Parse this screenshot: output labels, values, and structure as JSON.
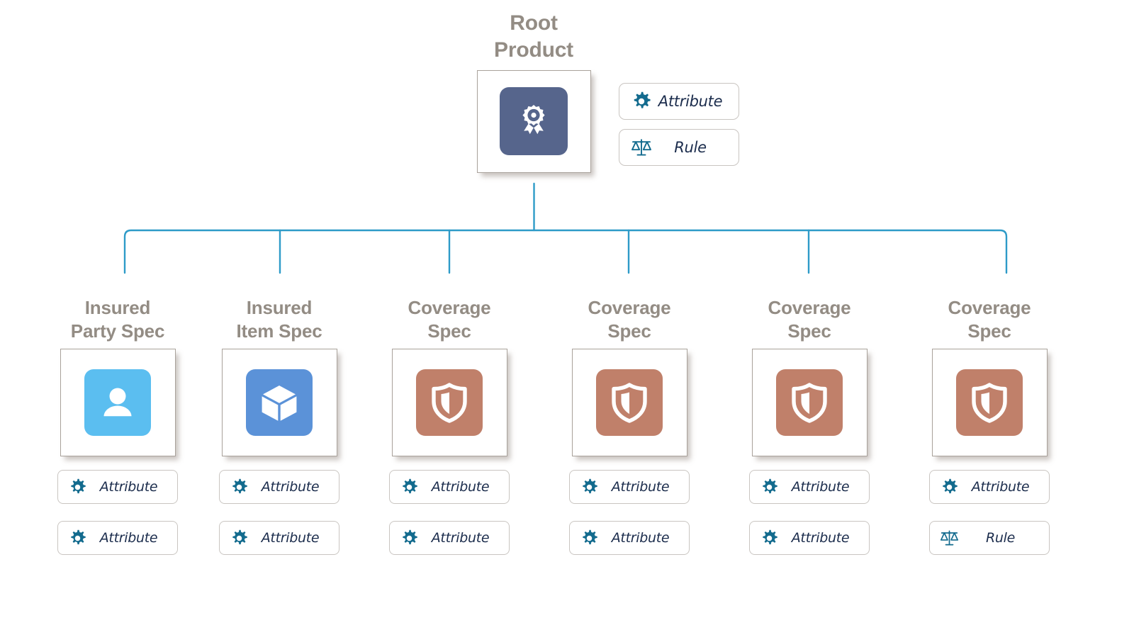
{
  "diagram": {
    "title_hidden": "",
    "colors": {
      "connector": "#2e9bc8",
      "label_text": "#938c84",
      "chip_border": "#c9c5c1",
      "chip_text": "#1b2c4c",
      "chip_icon": "#136b8e",
      "root_tile": "#56658c",
      "party_tile": "#5bbef0",
      "item_tile": "#5b92d8",
      "coverage_tile": "#c0806a",
      "node_border": "#a9a29b"
    },
    "root": {
      "label": "Root\nProduct",
      "icon": "award-ribbon-icon",
      "tile_color": "#56658c",
      "chips": [
        {
          "label": "Attribute",
          "icon": "gear-icon"
        },
        {
          "label": "Rule",
          "icon": "scales-icon"
        }
      ]
    },
    "children": [
      {
        "label": "Insured\nParty Spec",
        "icon": "person-icon",
        "tile_color": "#5bbef0",
        "chips": [
          {
            "label": "Attribute",
            "icon": "gear-icon"
          },
          {
            "label": "Attribute",
            "icon": "gear-icon"
          }
        ]
      },
      {
        "label": "Insured\nItem Spec",
        "icon": "cube-icon",
        "tile_color": "#5b92d8",
        "chips": [
          {
            "label": "Attribute",
            "icon": "gear-icon"
          },
          {
            "label": "Attribute",
            "icon": "gear-icon"
          }
        ]
      },
      {
        "label": "Coverage\nSpec",
        "icon": "shield-icon",
        "tile_color": "#c0806a",
        "chips": [
          {
            "label": "Attribute",
            "icon": "gear-icon"
          },
          {
            "label": "Attribute",
            "icon": "gear-icon"
          }
        ]
      },
      {
        "label": "Coverage\nSpec",
        "icon": "shield-icon",
        "tile_color": "#c0806a",
        "chips": [
          {
            "label": "Attribute",
            "icon": "gear-icon"
          },
          {
            "label": "Attribute",
            "icon": "gear-icon"
          }
        ]
      },
      {
        "label": "Coverage\nSpec",
        "icon": "shield-icon",
        "tile_color": "#c0806a",
        "chips": [
          {
            "label": "Attribute",
            "icon": "gear-icon"
          },
          {
            "label": "Attribute",
            "icon": "gear-icon"
          }
        ]
      },
      {
        "label": "Coverage\nSpec",
        "icon": "shield-icon",
        "tile_color": "#c0806a",
        "chips": [
          {
            "label": "Attribute",
            "icon": "gear-icon"
          },
          {
            "label": "Rule",
            "icon": "scales-icon"
          }
        ]
      }
    ]
  }
}
